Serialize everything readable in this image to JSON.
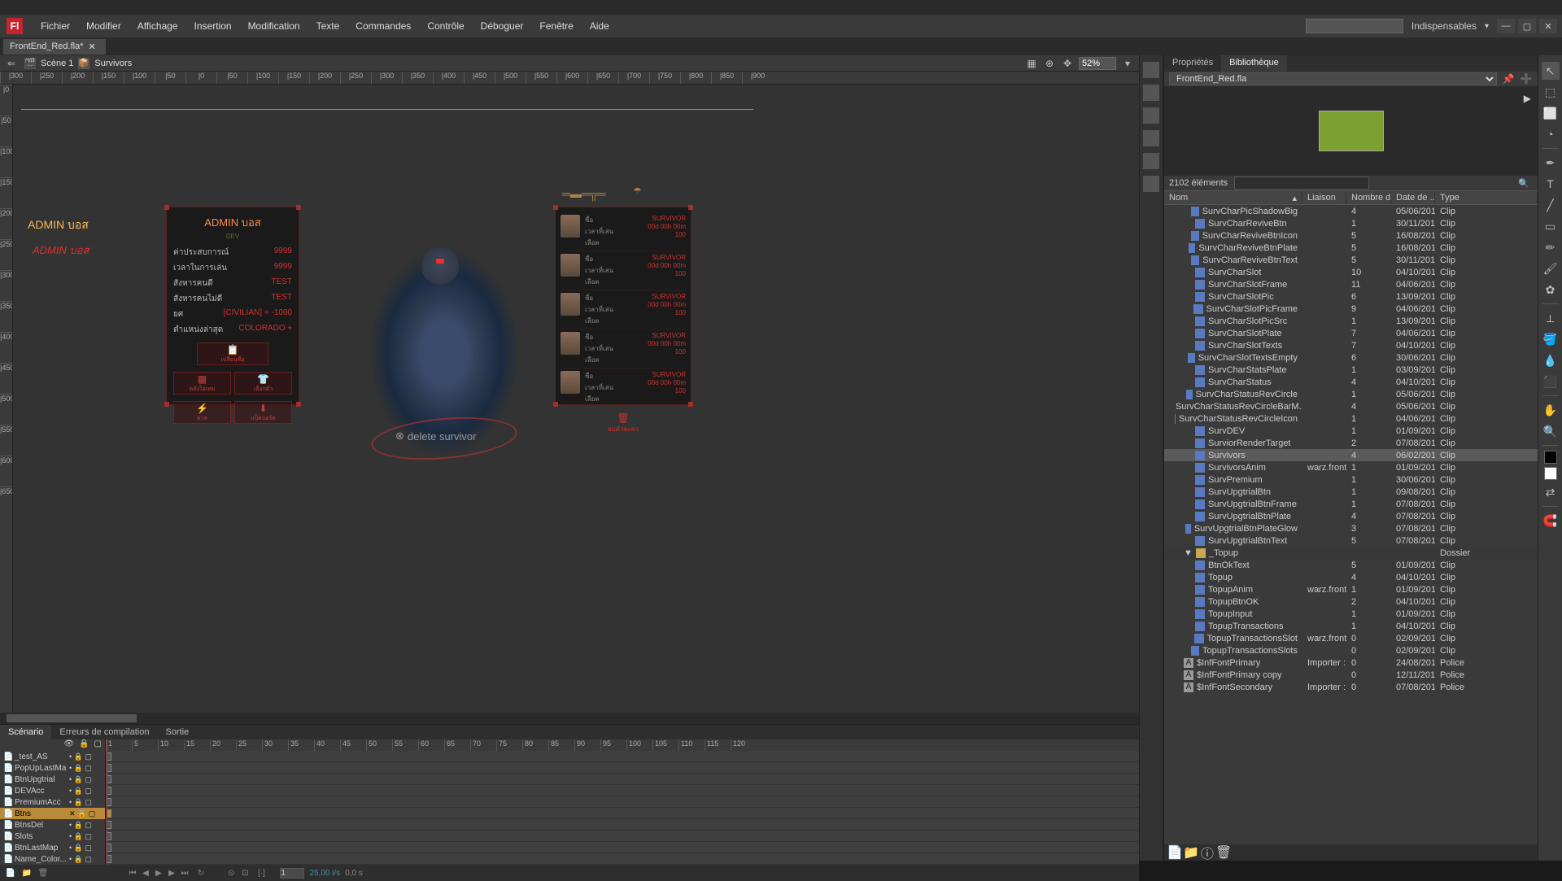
{
  "app": {
    "logo": "Fl",
    "workspace_dropdown": "Indispensables"
  },
  "menu": [
    "Fichier",
    "Modifier",
    "Affichage",
    "Insertion",
    "Modification",
    "Texte",
    "Commandes",
    "Contrôle",
    "Déboguer",
    "Fenêtre",
    "Aide"
  ],
  "document": {
    "tab_name": "FrontEnd_Red.fla*"
  },
  "breadcrumb": {
    "scene": "Scène 1",
    "symbol": "Survivors"
  },
  "zoom": "52%",
  "ruler_h": [
    "|300",
    "|250",
    "|200",
    "|150",
    "|100",
    "|50",
    "|0",
    "|50",
    "|100",
    "|150",
    "|200",
    "|250",
    "|300",
    "|350",
    "|400",
    "|450",
    "|500",
    "|550",
    "|600",
    "|650",
    "|700",
    "|750",
    "|800",
    "|850",
    "|900"
  ],
  "ruler_v": [
    "|0",
    "|50",
    "|100",
    "|150",
    "|200",
    "|250",
    "|300",
    "|350",
    "|400",
    "|450",
    "|500",
    "|550",
    "|600",
    "|650"
  ],
  "canvas": {
    "admin1": "ADMIN บอส",
    "admin2": "ADMIN บอส",
    "panel_left": {
      "title": "ADMIN บอส",
      "sub": "DEV",
      "stats": [
        {
          "label": "ค่าประสบการณ์",
          "value": "9999"
        },
        {
          "label": "เวลาในการเล่น",
          "value": "9999"
        },
        {
          "label": "สังหารคนดี",
          "value": "TEST"
        },
        {
          "label": "สังหารคนไม่ดี",
          "value": "TEST"
        },
        {
          "label": "ยศ",
          "value": "[CIVILIAN] = -1000"
        },
        {
          "label": "ตำแหน่งล่าสุด",
          "value": "COLORADO ⌖"
        }
      ],
      "btn_top": "เปลี่ยนชื่อ",
      "btn_row1": [
        "คลังไอเทม",
        "เลือกตัว"
      ],
      "btn_row2": [
        "ดวล",
        "แบ็คบอร์ด"
      ]
    },
    "panel_right": {
      "rows": [
        {
          "c1": "ชื่อ",
          "c2": "เวลาที่เล่น",
          "c3": "เลือด",
          "s1": "SURVIVOR",
          "s2": "00d 00h 00m",
          "s3": "100"
        },
        {
          "c1": "ชื่อ",
          "c2": "เวลาที่เล่น",
          "c3": "เลือด",
          "s1": "SURVIVOR",
          "s2": "00d 00h 00m",
          "s3": "100"
        },
        {
          "c1": "ชื่อ",
          "c2": "เวลาที่เล่น",
          "c3": "เลือด",
          "s1": "SURVIVOR",
          "s2": "00d 00h 00m",
          "s3": "100"
        },
        {
          "c1": "ชื่อ",
          "c2": "เวลาที่เล่น",
          "c3": "เลือด",
          "s1": "SURVIVOR",
          "s2": "00d 00h 00m",
          "s3": "100"
        },
        {
          "c1": "ชื่อ",
          "c2": "เวลาที่เล่น",
          "c3": "เลือด",
          "s1": "SURVIVOR",
          "s2": "00d 00h 00m",
          "s3": "100"
        }
      ],
      "delete_label": "ลบตัวละคร"
    },
    "delete_survivor": "delete survivor"
  },
  "timeline": {
    "tabs": [
      "Scénario",
      "Erreurs de compilation",
      "Sortie"
    ],
    "frames": [
      "1",
      "5",
      "10",
      "15",
      "20",
      "25",
      "30",
      "35",
      "40",
      "45",
      "50",
      "55",
      "60",
      "65",
      "70",
      "75",
      "80",
      "85",
      "90",
      "95",
      "100",
      "105",
      "110",
      "115",
      "120"
    ],
    "layers": [
      {
        "name": "_test_AS",
        "sel": false
      },
      {
        "name": "PopUpLastMap",
        "sel": false
      },
      {
        "name": "BtnUpgtrial",
        "sel": false
      },
      {
        "name": "DEVAcc",
        "sel": false
      },
      {
        "name": "PremiumAcc",
        "sel": false
      },
      {
        "name": "Btns",
        "sel": true
      },
      {
        "name": "BtnsDel",
        "sel": false
      },
      {
        "name": "Slots",
        "sel": false
      },
      {
        "name": "BtnLastMap",
        "sel": false
      },
      {
        "name": "Name_Color...",
        "sel": false
      }
    ],
    "footer": {
      "frame": "1",
      "fps": "25,00 i/s",
      "time": "0,0 s"
    }
  },
  "right_panel": {
    "tabs": [
      "Propriétés",
      "Bibliothèque"
    ],
    "library_name": "FrontEnd_Red.fla",
    "item_count": "2102 éléments",
    "columns": [
      "Nom",
      "Liaison",
      "Nombre d...",
      "Date de ...",
      "Type"
    ],
    "items": [
      {
        "indent": 2,
        "icon": "clip",
        "name": "SurvCharPicShadowBig",
        "link": "",
        "use": "4",
        "date": "05/06/201...",
        "type": "Clip"
      },
      {
        "indent": 2,
        "icon": "clip",
        "name": "SurvCharReviveBtn",
        "link": "",
        "use": "1",
        "date": "30/11/201...",
        "type": "Clip"
      },
      {
        "indent": 2,
        "icon": "clip",
        "name": "SurvCharReviveBtnIcon",
        "link": "",
        "use": "5",
        "date": "16/08/201...",
        "type": "Clip"
      },
      {
        "indent": 2,
        "icon": "clip",
        "name": "SurvCharReviveBtnPlate",
        "link": "",
        "use": "5",
        "date": "16/08/201...",
        "type": "Clip"
      },
      {
        "indent": 2,
        "icon": "clip",
        "name": "SurvCharReviveBtnText",
        "link": "",
        "use": "5",
        "date": "30/11/201...",
        "type": "Clip"
      },
      {
        "indent": 2,
        "icon": "clip",
        "name": "SurvCharSlot",
        "link": "",
        "use": "10",
        "date": "04/10/201...",
        "type": "Clip"
      },
      {
        "indent": 2,
        "icon": "clip",
        "name": "SurvCharSlotFrame",
        "link": "",
        "use": "11",
        "date": "04/06/201...",
        "type": "Clip"
      },
      {
        "indent": 2,
        "icon": "clip",
        "name": "SurvCharSlotPic",
        "link": "",
        "use": "6",
        "date": "13/09/201...",
        "type": "Clip"
      },
      {
        "indent": 2,
        "icon": "clip",
        "name": "SurvCharSlotPicFrame",
        "link": "",
        "use": "9",
        "date": "04/06/201...",
        "type": "Clip"
      },
      {
        "indent": 2,
        "icon": "clip",
        "name": "SurvCharSlotPicSrc",
        "link": "",
        "use": "1",
        "date": "13/09/201...",
        "type": "Clip"
      },
      {
        "indent": 2,
        "icon": "clip",
        "name": "SurvCharSlotPlate",
        "link": "",
        "use": "7",
        "date": "04/06/201...",
        "type": "Clip"
      },
      {
        "indent": 2,
        "icon": "clip",
        "name": "SurvCharSlotTexts",
        "link": "",
        "use": "7",
        "date": "04/10/201...",
        "type": "Clip"
      },
      {
        "indent": 2,
        "icon": "clip",
        "name": "SurvCharSlotTextsEmpty",
        "link": "",
        "use": "6",
        "date": "30/06/201...",
        "type": "Clip"
      },
      {
        "indent": 2,
        "icon": "clip",
        "name": "SurvCharStatsPlate",
        "link": "",
        "use": "1",
        "date": "03/09/201...",
        "type": "Clip"
      },
      {
        "indent": 2,
        "icon": "clip",
        "name": "SurvCharStatus",
        "link": "",
        "use": "4",
        "date": "04/10/201...",
        "type": "Clip"
      },
      {
        "indent": 2,
        "icon": "clip",
        "name": "SurvCharStatusRevCircle",
        "link": "",
        "use": "1",
        "date": "05/06/201...",
        "type": "Clip"
      },
      {
        "indent": 2,
        "icon": "clip",
        "name": "SurvCharStatusRevCircleBarM...",
        "link": "",
        "use": "4",
        "date": "05/06/201...",
        "type": "Clip"
      },
      {
        "indent": 2,
        "icon": "clip",
        "name": "SurvCharStatusRevCircleIcon",
        "link": "",
        "use": "1",
        "date": "04/06/201...",
        "type": "Clip"
      },
      {
        "indent": 2,
        "icon": "clip",
        "name": "SurvDEV",
        "link": "",
        "use": "1",
        "date": "01/09/201...",
        "type": "Clip"
      },
      {
        "indent": 2,
        "icon": "clip",
        "name": "SurviorRenderTarget",
        "link": "",
        "use": "2",
        "date": "07/08/201...",
        "type": "Clip"
      },
      {
        "indent": 2,
        "icon": "clip",
        "name": "Survivors",
        "link": "",
        "use": "4",
        "date": "06/02/201...",
        "type": "Clip",
        "selected": true
      },
      {
        "indent": 2,
        "icon": "clip",
        "name": "SurvivorsAnim",
        "link": "warz.front...",
        "use": "1",
        "date": "01/09/201...",
        "type": "Clip"
      },
      {
        "indent": 2,
        "icon": "clip",
        "name": "SurvPremium",
        "link": "",
        "use": "1",
        "date": "30/06/201...",
        "type": "Clip"
      },
      {
        "indent": 2,
        "icon": "clip",
        "name": "SurvUpgtrialBtn",
        "link": "",
        "use": "1",
        "date": "09/08/201...",
        "type": "Clip"
      },
      {
        "indent": 2,
        "icon": "clip",
        "name": "SurvUpgtrialBtnFrame",
        "link": "",
        "use": "1",
        "date": "07/08/201...",
        "type": "Clip"
      },
      {
        "indent": 2,
        "icon": "clip",
        "name": "SurvUpgtrialBtnPlate",
        "link": "",
        "use": "4",
        "date": "07/08/201...",
        "type": "Clip"
      },
      {
        "indent": 2,
        "icon": "clip",
        "name": "SurvUpgtrialBtnPlateGlow",
        "link": "",
        "use": "3",
        "date": "07/08/201...",
        "type": "Clip"
      },
      {
        "indent": 2,
        "icon": "clip",
        "name": "SurvUpgtrialBtnText",
        "link": "",
        "use": "5",
        "date": "07/08/201...",
        "type": "Clip"
      },
      {
        "indent": 1,
        "icon": "folder",
        "name": "_Topup",
        "link": "",
        "use": "",
        "date": "",
        "type": "Dossier",
        "folder": true
      },
      {
        "indent": 2,
        "icon": "clip",
        "name": "BtnOkText",
        "link": "",
        "use": "5",
        "date": "01/09/201...",
        "type": "Clip"
      },
      {
        "indent": 2,
        "icon": "clip",
        "name": "Topup",
        "link": "",
        "use": "4",
        "date": "04/10/201...",
        "type": "Clip"
      },
      {
        "indent": 2,
        "icon": "clip",
        "name": "TopupAnim",
        "link": "warz.front...",
        "use": "1",
        "date": "01/09/201...",
        "type": "Clip"
      },
      {
        "indent": 2,
        "icon": "clip",
        "name": "TopupBtnOK",
        "link": "",
        "use": "2",
        "date": "04/10/201...",
        "type": "Clip"
      },
      {
        "indent": 2,
        "icon": "clip",
        "name": "TopupInput",
        "link": "",
        "use": "1",
        "date": "01/09/201...",
        "type": "Clip"
      },
      {
        "indent": 2,
        "icon": "clip",
        "name": "TopupTransactions",
        "link": "",
        "use": "1",
        "date": "04/10/201...",
        "type": "Clip"
      },
      {
        "indent": 2,
        "icon": "clip",
        "name": "TopupTransactionsSlot",
        "link": "warz.front...",
        "use": "0",
        "date": "02/09/201...",
        "type": "Clip"
      },
      {
        "indent": 2,
        "icon": "clip",
        "name": "TopupTransactionsSlots",
        "link": "",
        "use": "0",
        "date": "02/09/201...",
        "type": "Clip"
      },
      {
        "indent": 1,
        "icon": "font",
        "name": "$InfFontPrimary",
        "link": "Importer :...",
        "use": "0",
        "date": "24/08/201...",
        "type": "Police"
      },
      {
        "indent": 1,
        "icon": "font",
        "name": "$InfFontPrimary copy",
        "link": "",
        "use": "0",
        "date": "12/11/201...",
        "type": "Police"
      },
      {
        "indent": 1,
        "icon": "font",
        "name": "$InfFontSecondary",
        "link": "Importer :...",
        "use": "0",
        "date": "07/08/201...",
        "type": "Police"
      }
    ]
  }
}
